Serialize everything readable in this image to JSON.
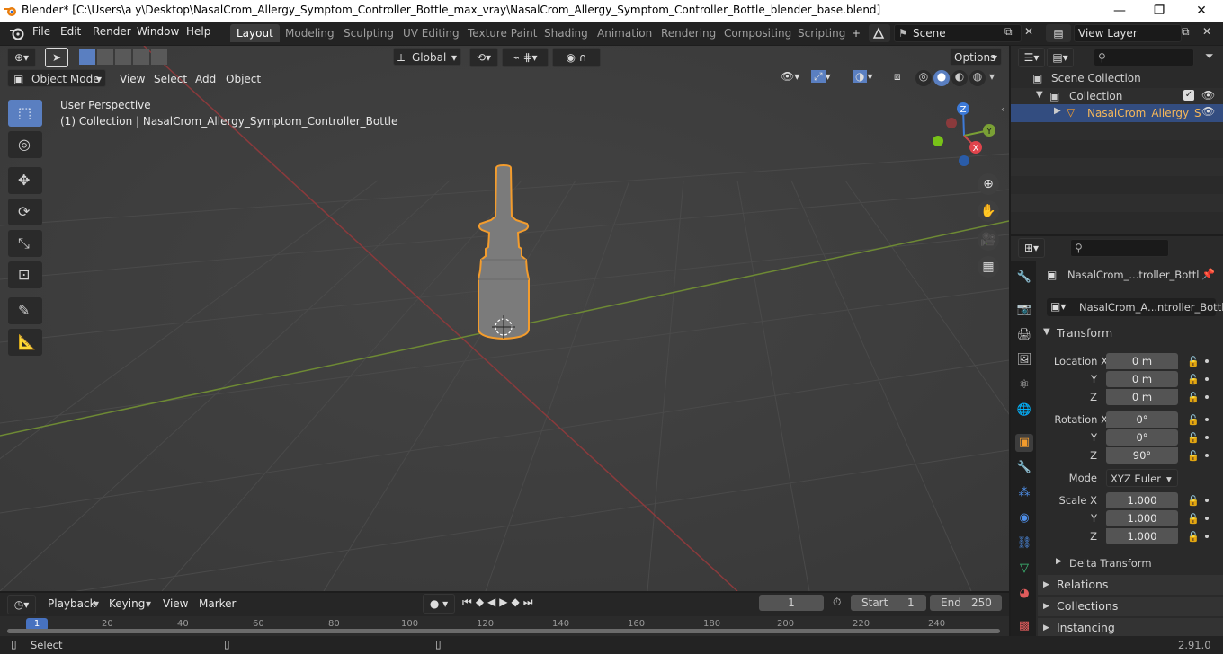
{
  "window": {
    "title": "Blender* [C:\\Users\\a y\\Desktop\\NasalCrom_Allergy_Symptom_Controller_Bottle_max_vray\\NasalCrom_Allergy_Symptom_Controller_Bottle_blender_base.blend]",
    "minimize": "—",
    "maximize": "❐",
    "close": "✕"
  },
  "menu": {
    "items": [
      "File",
      "Edit",
      "Render",
      "Window",
      "Help"
    ]
  },
  "workspaces": [
    "Layout",
    "Modeling",
    "Sculpting",
    "UV Editing",
    "Texture Paint",
    "Shading",
    "Animation",
    "Rendering",
    "Compositing",
    "Scripting"
  ],
  "workspace_add": "+",
  "scene": {
    "name": "Scene"
  },
  "view_layer": {
    "name": "View Layer"
  },
  "viewport_header": {
    "transform_orientation": "Global",
    "options": "Options",
    "mode": "Object Mode",
    "menus": [
      "View",
      "Select",
      "Add",
      "Object"
    ]
  },
  "viewport": {
    "perspective": "User Perspective",
    "collection_info": "(1) Collection | NasalCrom_Allergy_Symptom_Controller_Bottle",
    "gizmo": {
      "z": "Z",
      "y": "Y",
      "x": "X"
    }
  },
  "outliner": {
    "root": "Scene Collection",
    "collection": "Collection",
    "object": "NasalCrom_Allergy_S"
  },
  "properties": {
    "object_name": "NasalCrom_...troller_Bottl",
    "data_name": "NasalCrom_A...ntroller_Bottle",
    "transform_title": "Transform",
    "location_label": "Location X",
    "rotation_label": "Rotation X",
    "scale_label": "Scale X",
    "y_label": "Y",
    "z_label": "Z",
    "location": [
      "0 m",
      "0 m",
      "0 m"
    ],
    "rotation": [
      "0°",
      "0°",
      "90°"
    ],
    "mode_label": "Mode",
    "mode_value": "XYZ Euler",
    "scale": [
      "1.000",
      "1.000",
      "1.000"
    ],
    "delta_transform": "Delta Transform",
    "relations": "Relations",
    "collections": "Collections",
    "instancing": "Instancing"
  },
  "timeline": {
    "menus": [
      "Playback",
      "Keying",
      "View",
      "Marker"
    ],
    "current_frame": "1",
    "start_label": "Start",
    "start_value": "1",
    "end_label": "End",
    "end_value": "250",
    "ruler": [
      "1",
      "20",
      "40",
      "60",
      "80",
      "100",
      "120",
      "140",
      "160",
      "180",
      "200",
      "220",
      "240"
    ]
  },
  "status": {
    "left": "Select",
    "version": "2.91.0"
  },
  "colors": {
    "selection_outline": "#f39c2d",
    "active_tool": "#5a7fc1",
    "x_axis": "#c8484d",
    "y_axis": "#7aa035",
    "z_axis": "#3d7ad8"
  }
}
